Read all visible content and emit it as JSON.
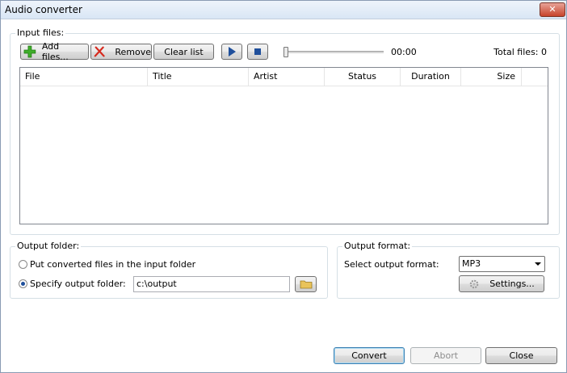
{
  "window": {
    "title": "Audio converter",
    "close_glyph": "✕"
  },
  "input_files": {
    "group_label": "Input files:",
    "add_files_label": "Add files...",
    "remove_label": "Remove",
    "clear_list_label": "Clear list",
    "time": "00:00",
    "total_files": "Total files: 0",
    "columns": [
      "File",
      "Title",
      "Artist",
      "Status",
      "Duration",
      "Size"
    ],
    "rows": []
  },
  "output_folder": {
    "group_label": "Output folder:",
    "option_input_folder": "Put converted files in the input folder",
    "option_specify": "Specify output folder:",
    "selected_option": "specify",
    "path": "c:\\output"
  },
  "output_format": {
    "group_label": "Output format:",
    "select_label": "Select output format:",
    "selected_format": "MP3",
    "settings_label": "Settings..."
  },
  "footer": {
    "convert_label": "Convert",
    "abort_label": "Abort",
    "close_label": "Close"
  },
  "colors": {
    "add_icon": "#3fae2a",
    "remove_icon": "#d62a1e",
    "play_icon": "#1f4f9b",
    "folder_icon": "#e9c35a"
  }
}
